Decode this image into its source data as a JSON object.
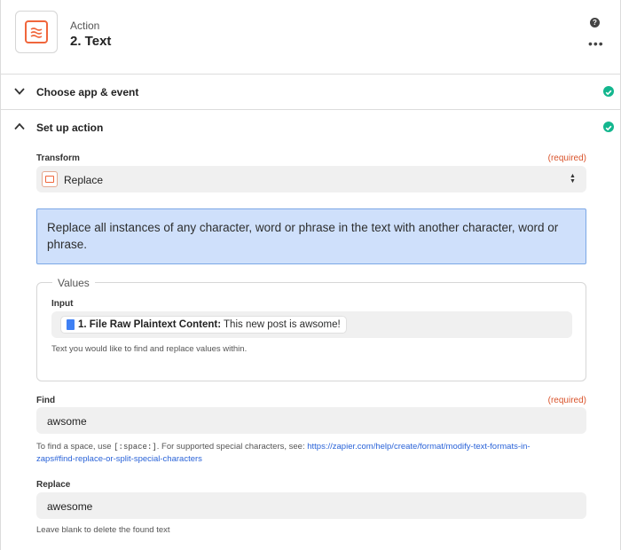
{
  "header": {
    "step_kind": "Action",
    "step_title": "2. Text",
    "help_glyph": "?",
    "more_glyph": "•••"
  },
  "sections": {
    "choose": {
      "label": "Choose app & event",
      "status": "complete"
    },
    "setup": {
      "label": "Set up action",
      "status": "complete"
    }
  },
  "transform": {
    "label": "Transform",
    "required": "(required)",
    "value": "Replace"
  },
  "info_text": "Replace all instances of any character, word or phrase in the text with another character, word or phrase.",
  "values_group": {
    "legend": "Values",
    "input_label": "Input",
    "token_source": "1. File Raw Plaintext Content:",
    "token_value": "This new post is awsome!",
    "help": "Text you would like to find and replace values within."
  },
  "find": {
    "label": "Find",
    "required": "(required)",
    "value": "awsome",
    "help_prefix": "To find a space, use",
    "help_code": "[:space:]",
    "help_middle": ". For supported special characters, see:",
    "help_link_1": "https://zapier.com/help/create/format/modify-text-formats-in-",
    "help_link_2": "zaps#find-replace-or-split-special-characters"
  },
  "replace": {
    "label": "Replace",
    "value": "awesome",
    "help": "Leave blank to delete the found text"
  },
  "colors": {
    "accent": "#f0663c",
    "success": "#13b68e",
    "info_bg": "#cfe0fb",
    "info_border": "#7ba7e6",
    "required": "#d9532b",
    "link": "#2a63d8"
  }
}
